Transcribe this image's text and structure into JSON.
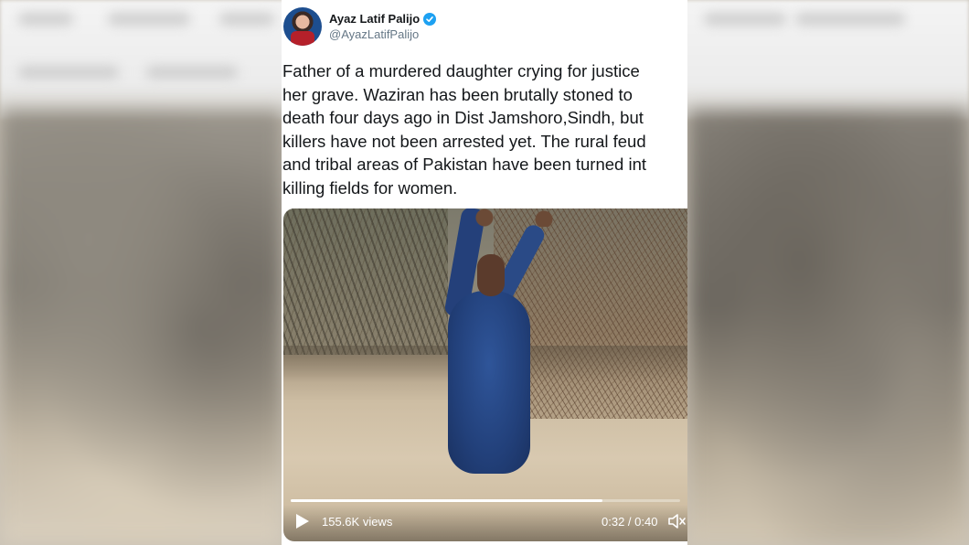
{
  "tweet": {
    "author_name": "Ayaz Latif Palijo",
    "author_handle": "@AyazLatifPalijo",
    "verified": true,
    "text": "Father of a murdered daughter crying for justice\nher grave. Waziran has been brutally stoned to\ndeath four days ago in Dist Jamshoro,Sindh, but\nkillers have not been arrested yet. The rural feud\nand tribal areas of Pakistan have been turned int\nkilling fields for women."
  },
  "video": {
    "views": "155.6K views",
    "time": "0:32 / 0:40",
    "progress_fraction": 0.8,
    "play_icon": "play-icon",
    "volume_icon": "volume-icon"
  },
  "colors": {
    "verified_badge": "#1da1f2",
    "handle_text": "#657786",
    "body_text": "#14171a"
  }
}
